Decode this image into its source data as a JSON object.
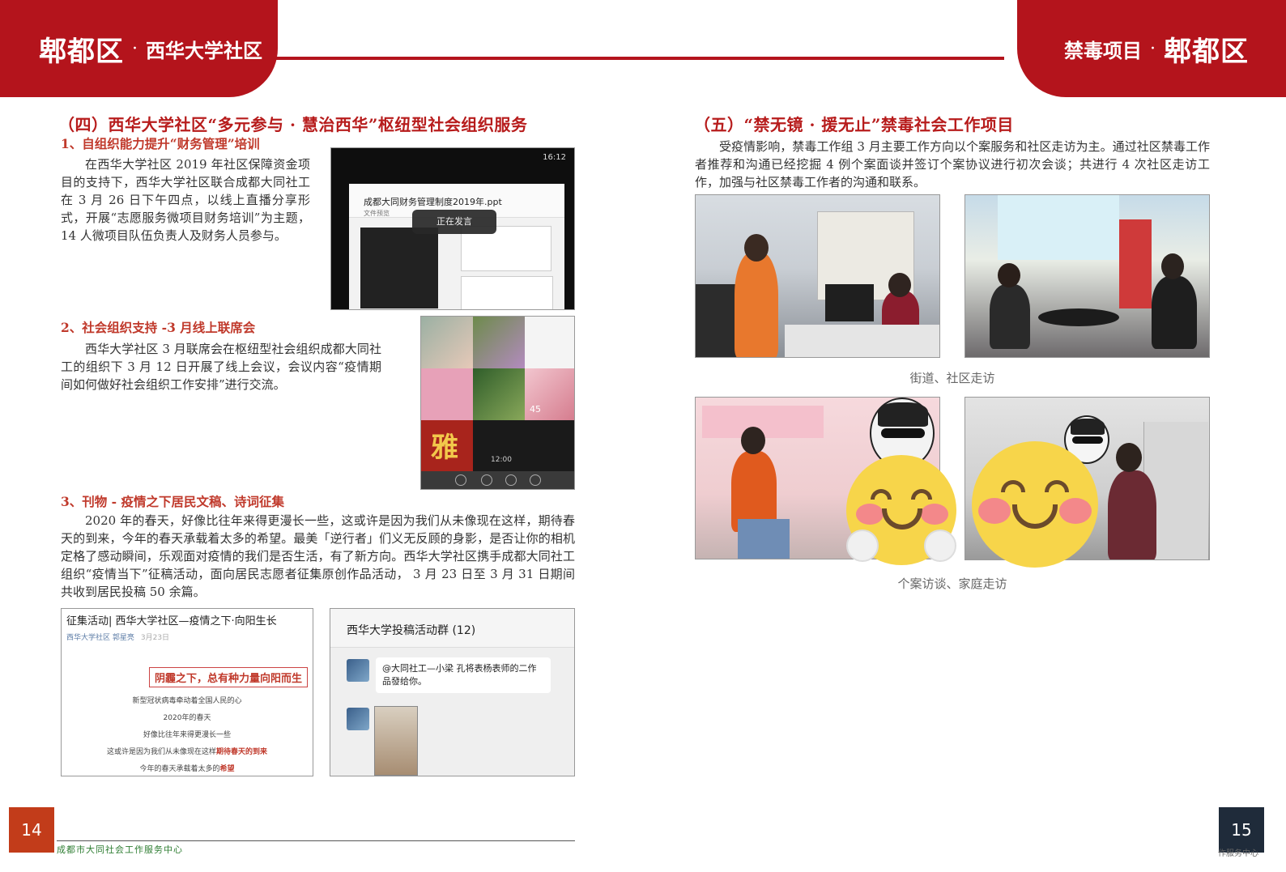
{
  "header": {
    "left": {
      "district": "郫都区",
      "dot": "·",
      "community": "西华大学社区"
    },
    "right": {
      "project": "禁毒项目",
      "dot": "·",
      "district": "郫都区"
    }
  },
  "left_page": {
    "section_title": "（四）西华大学社区“多元参与 · 慧治西华”枢纽型社会组织服务",
    "item1": {
      "title": "1、自组织能力提升“财务管理”培训",
      "body": "在西华大学社区 2019 年社区保障资金项目的支持下，西华大学社区联合成都大同社工在 3 月 26 日下午四点，以线上直播分享形式，开展“志愿服务微项目财务培训”为主题，14 人微项目队伍负责人及财务人员参与。"
    },
    "phone": {
      "status_time": "16:12",
      "chat_title": "成都大同财务管理制度2019年.ppt",
      "chat_sub": "文件预览",
      "badge": "正在发言"
    },
    "item2": {
      "title": "2、社会组织支持 -3 月线上联席会",
      "body": "西华大学社区 3 月联席会在枢纽型社会组织成都大同社工的组织下 3 月 12 日开展了线上会议，会议内容“疫情期间如何做好社会组织工作安排”进行交流。"
    },
    "grid": {
      "poster_char": "雅",
      "counter": "45",
      "time": "12:00"
    },
    "item3": {
      "title": "3、刊物 - 疫情之下居民文稿、诗词征集",
      "body": "2020 年的春天，好像比往年来得更漫长一些，这或许是因为我们从未像现在这样，期待春天的到来，今年的春天承载着太多的希望。最美「逆行者」们义无反顾的身影，是否让你的相机定格了感动瞬间，乐观面对疫情的我们是否生活，有了新方向。西华大学社区携手成都大同社工组织“疫情当下”征稿活动，面向居民志愿者征集原创作品活动， 3 月 23 日至 3 月 31 日期间共收到居民投稿 50 余篇。"
    },
    "article": {
      "title": "征集活动| 西华大学社区—疫情之下·向阳生长",
      "author": "西华大学社区 郭星亮",
      "date": "3月23日",
      "headline": "阴霾之下，总有种力量向阳而生",
      "line1": "新型冠状病毒牵动着全国人民的心",
      "line2": "2020年的春天",
      "line3": "好像比往年来得更漫长一些",
      "line4a": "这或许是因为我们从未像现在这样",
      "line4b": "期待春天的到来",
      "line5a": "今年的春天承载着太多的",
      "line5b": "希望"
    },
    "chat": {
      "title": "西华大学投稿活动群 (12)",
      "message": "@大同社工—小梁 孔将表杨表师的二作品發给你。"
    }
  },
  "right_page": {
    "section_title": "（五）“禁无镜 · 援无止”禁毒社会工作项目",
    "body": "受疫情影响，禁毒工作组 3 月主要工作方向以个案服务和社区走访为主。通过社区禁毒工作者推荐和沟通已经挖掘 4 例个案面谈并签订个案协议进行初次会谈；共进行 4 次社区走访工作，加强与社区禁毒工作者的沟通和联系。",
    "caption1": "街道、社区走访",
    "caption2": "个案访谈、家庭走访"
  },
  "footer": {
    "page_left": "14",
    "page_right": "15",
    "org": "成都市大同社会工作服务中心",
    "org_right": "作服务中心"
  },
  "colors": {
    "brand_red": "#b4141c",
    "title_red": "#b71c1c",
    "footer_green": "#2e7d32"
  }
}
